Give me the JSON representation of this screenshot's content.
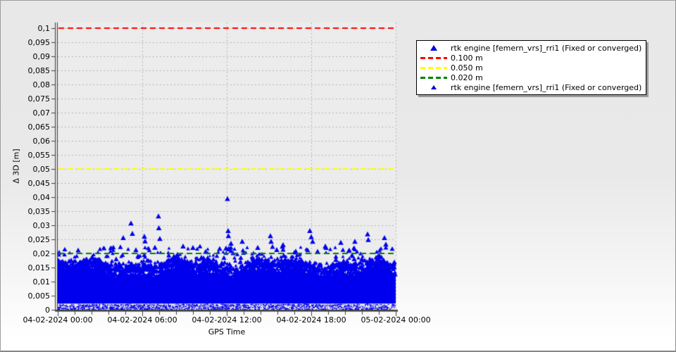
{
  "window": {
    "plot_bg": "#ececec",
    "page_bg_top": "#e8e8e8",
    "page_bg_bottom": "#ffffff",
    "axis_color": "#3f3f3f"
  },
  "chart_data": {
    "type": "scatter",
    "title": "",
    "xlabel": "GPS Time",
    "ylabel": "Δ 3D [m]",
    "x_tick_labels": [
      "04-02-2024 00:00",
      "04-02-2024 06:00",
      "04-02-2024 12:00",
      "04-02-2024 18:00",
      "05-02-2024 00:00"
    ],
    "x_tick_hours": [
      0,
      6,
      12,
      18,
      24
    ],
    "x_minor_tick_step_hours": 1.2,
    "y_tick_labels_top_to_bottom": [
      "0,1",
      "0,095",
      "0,09",
      "0,085",
      "0,08",
      "0,075",
      "0,07",
      "0,065",
      "0,06",
      "0,055",
      "0,05",
      "0,045",
      "0,04",
      "0,035",
      "0,03",
      "0,025",
      "0,02",
      "0,015",
      "0,01",
      "0,005",
      "0"
    ],
    "y_tick_step": 0.005,
    "ylim": [
      0,
      0.102
    ],
    "xlim_hours": [
      0,
      24
    ],
    "grid": {
      "h_color": "#b6b6b6",
      "v_color": "#b6b6b6",
      "h_on": true,
      "v_on": true
    },
    "series": [
      {
        "name": "rtk engine [femern_vrs]_rri1 (Fixed or converged)",
        "marker": "triangle",
        "color": "#0000ee",
        "description": "dense 1 Hz epochs over 24 h: solid band 0 to ~0.018 m, occasional spikes up to ~0.04 m"
      }
    ],
    "thresholds": [
      {
        "label": "0.100 m",
        "value": 0.1,
        "color": "#ff0000"
      },
      {
        "label": "0.050 m",
        "value": 0.05,
        "color": "#ffff00"
      },
      {
        "label": "0.020 m",
        "value": 0.02,
        "color": "#008000"
      }
    ],
    "scatter_gen": {
      "seed": 1337,
      "band_floor": 0.0022,
      "band_top_base": 0.0128,
      "band_top_wave1_amp": 0.0012,
      "band_top_wave2_amp": 0.0009,
      "band_top_jitter": 0.0016,
      "n_peak_triangles": 1400,
      "n_outlier_triangles": 320,
      "outlier_min": 0.0155,
      "outlier_span": 0.007,
      "n_floor_specks": 1700,
      "spikes_hours_value_m": [
        [
          4.65,
          0.0255
        ],
        [
          5.2,
          0.0307
        ],
        [
          5.3,
          0.027
        ],
        [
          6.15,
          0.026
        ],
        [
          6.2,
          0.0243
        ],
        [
          7.15,
          0.0332
        ],
        [
          7.18,
          0.029
        ],
        [
          7.25,
          0.0252
        ],
        [
          8.9,
          0.0225
        ],
        [
          9.6,
          0.022
        ],
        [
          11.95,
          0.0218
        ],
        [
          12.05,
          0.0394
        ],
        [
          12.1,
          0.028
        ],
        [
          12.12,
          0.0262
        ],
        [
          12.3,
          0.0235
        ],
        [
          13.1,
          0.0242
        ],
        [
          14.2,
          0.022
        ],
        [
          15.1,
          0.0262
        ],
        [
          15.15,
          0.0242
        ],
        [
          16.0,
          0.023
        ],
        [
          17.9,
          0.028
        ],
        [
          18.0,
          0.0258
        ],
        [
          18.1,
          0.0242
        ],
        [
          19.0,
          0.0225
        ],
        [
          20.1,
          0.0238
        ],
        [
          21.1,
          0.0242
        ],
        [
          22.0,
          0.0268
        ],
        [
          22.05,
          0.0248
        ],
        [
          23.2,
          0.0255
        ],
        [
          23.3,
          0.0232
        ]
      ]
    }
  },
  "legend": {
    "entries": [
      {
        "marker": "triangle",
        "color": "#0000dd",
        "size": 10,
        "label": "rtk engine [femern_vrs]_rri1 (Fixed or converged)"
      },
      {
        "marker": "dash",
        "color": "#ff0000",
        "label": "0.100 m"
      },
      {
        "marker": "dash",
        "color": "#ffff00",
        "label": "0.050 m"
      },
      {
        "marker": "dash",
        "color": "#008000",
        "label": "0.020 m"
      },
      {
        "marker": "triangle",
        "color": "#0000dd",
        "size": 8,
        "label": "rtk engine [femern_vrs]_rri1 (Fixed or converged)"
      }
    ]
  }
}
